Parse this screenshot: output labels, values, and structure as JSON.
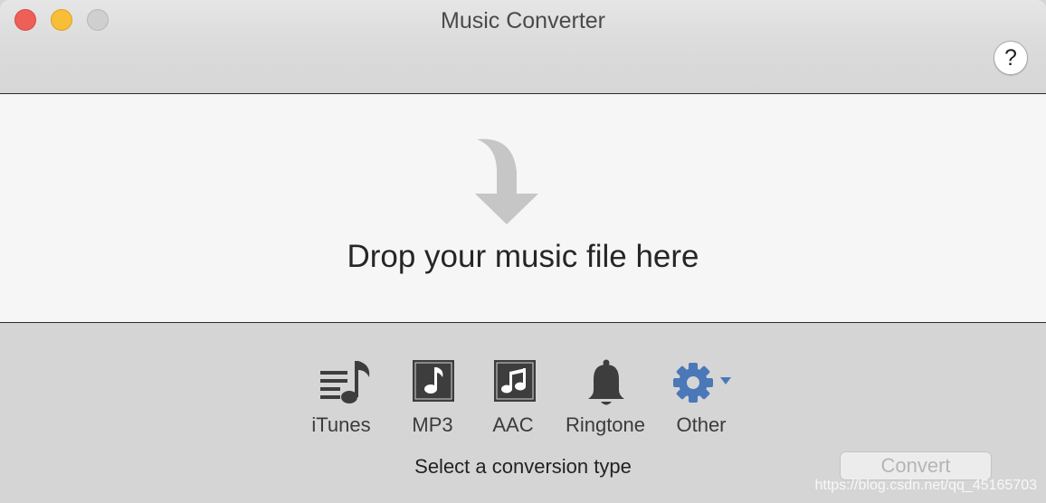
{
  "window": {
    "title": "Music Converter"
  },
  "help": {
    "label": "?"
  },
  "dropzone": {
    "text": "Drop your music file here"
  },
  "conversion_types": [
    {
      "label": "iTunes",
      "icon": "itunes-list-note-icon"
    },
    {
      "label": "MP3",
      "icon": "mp3-note-icon"
    },
    {
      "label": "AAC",
      "icon": "aac-note-icon"
    },
    {
      "label": "Ringtone",
      "icon": "bell-icon"
    },
    {
      "label": "Other",
      "icon": "gear-dropdown-icon"
    }
  ],
  "footer": {
    "prompt": "Select a conversion type",
    "convert_label": "Convert"
  },
  "watermark": "https://blog.csdn.net/qq_45165703",
  "colors": {
    "close": "#ee5f58",
    "minimize": "#f8be37",
    "maximize": "#cfcfcf",
    "gear_blue": "#4a78b8"
  }
}
